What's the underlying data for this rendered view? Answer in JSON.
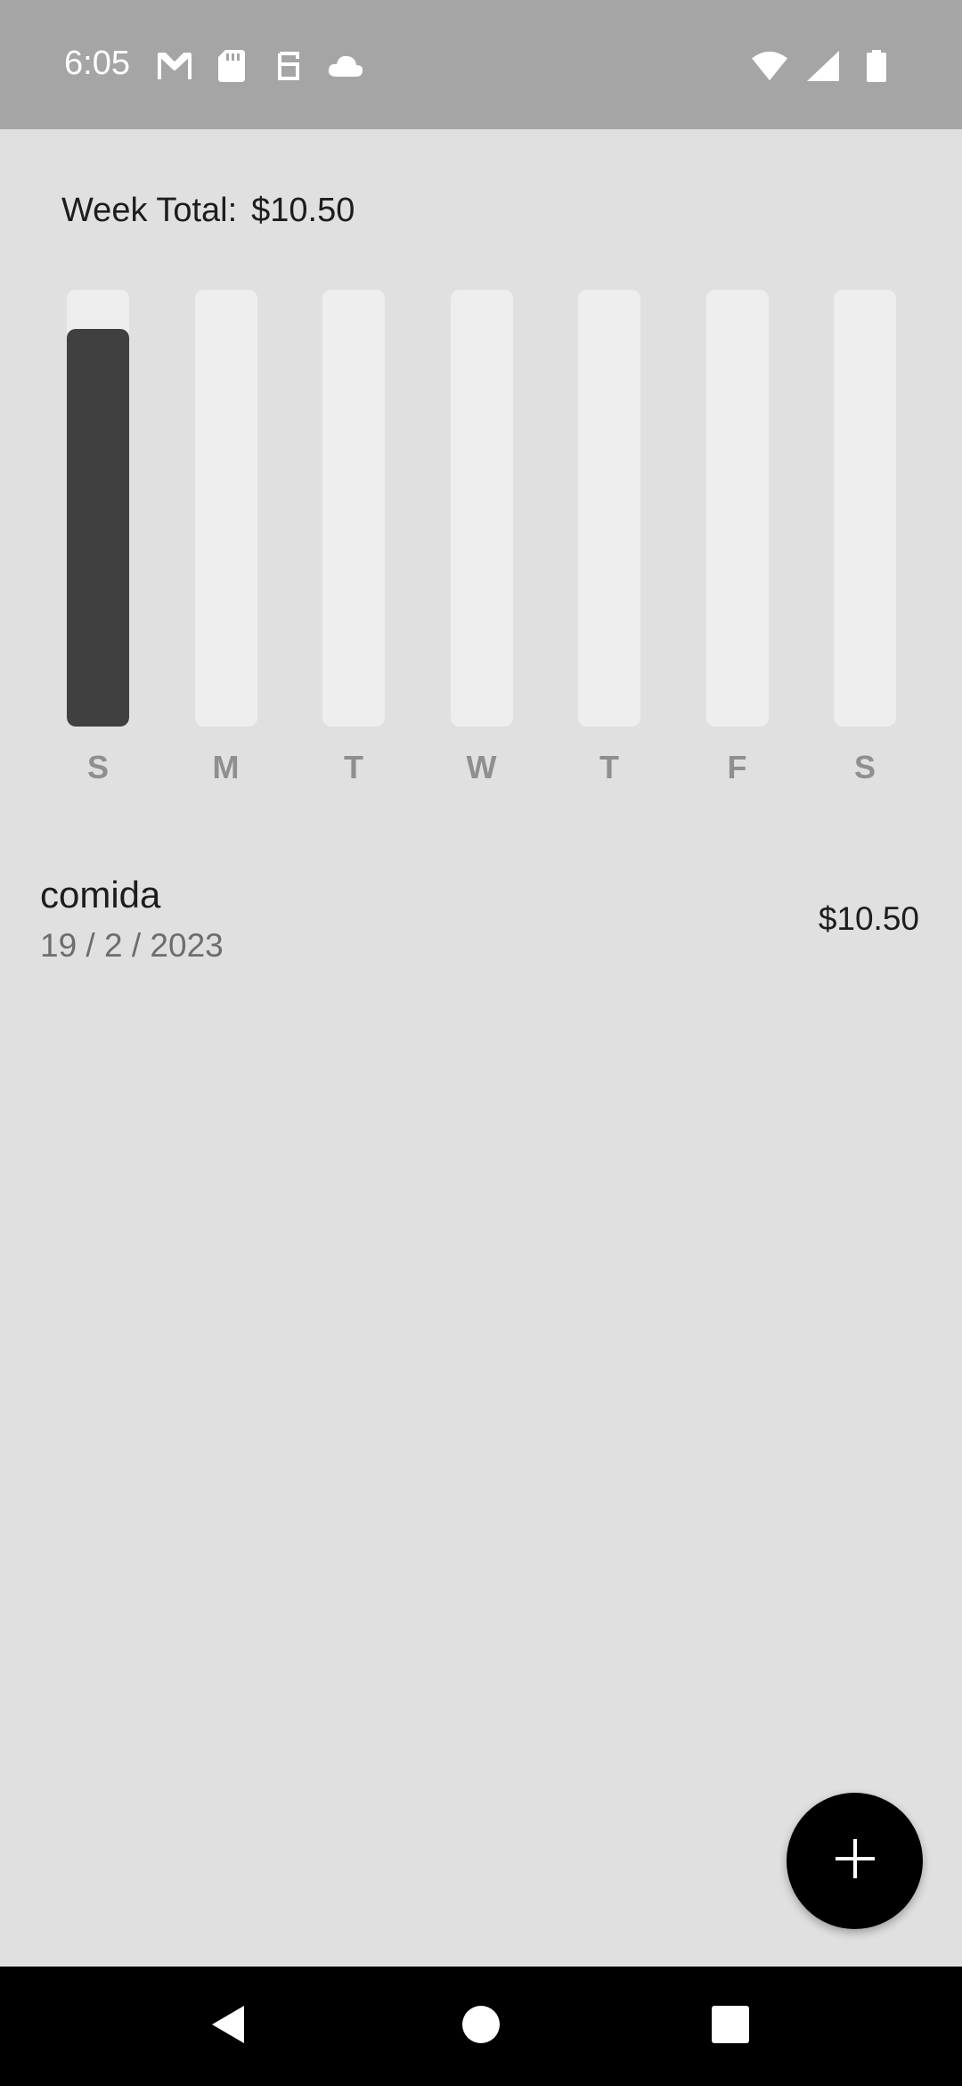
{
  "status_bar": {
    "time": "6:05",
    "left_icons": [
      "gmail-icon",
      "sd-card-icon",
      "app-icon",
      "cloud-icon"
    ],
    "right_icons": [
      "wifi-icon",
      "signal-icon",
      "battery-icon"
    ]
  },
  "summary": {
    "label": "Week Total:",
    "amount": "$10.50"
  },
  "chart_data": {
    "type": "bar",
    "categories": [
      "S",
      "M",
      "T",
      "W",
      "T",
      "F",
      "S"
    ],
    "values": [
      0.91,
      0,
      0,
      0,
      0,
      0,
      0
    ],
    "ylim": [
      0,
      1
    ],
    "fill_color": "#404040",
    "track_color": "#eeeeee"
  },
  "transactions": [
    {
      "title": "comida",
      "date": "19 / 2 / 2023",
      "amount": "$10.50"
    }
  ],
  "fab": {
    "icon": "plus-icon"
  },
  "nav_bar": {
    "buttons": [
      "back-icon",
      "home-icon",
      "recents-icon"
    ]
  },
  "colors": {
    "status_bar": "#a5a5a5",
    "background": "#e0e0e0",
    "fab": "#000000",
    "nav_bar": "#000000"
  }
}
